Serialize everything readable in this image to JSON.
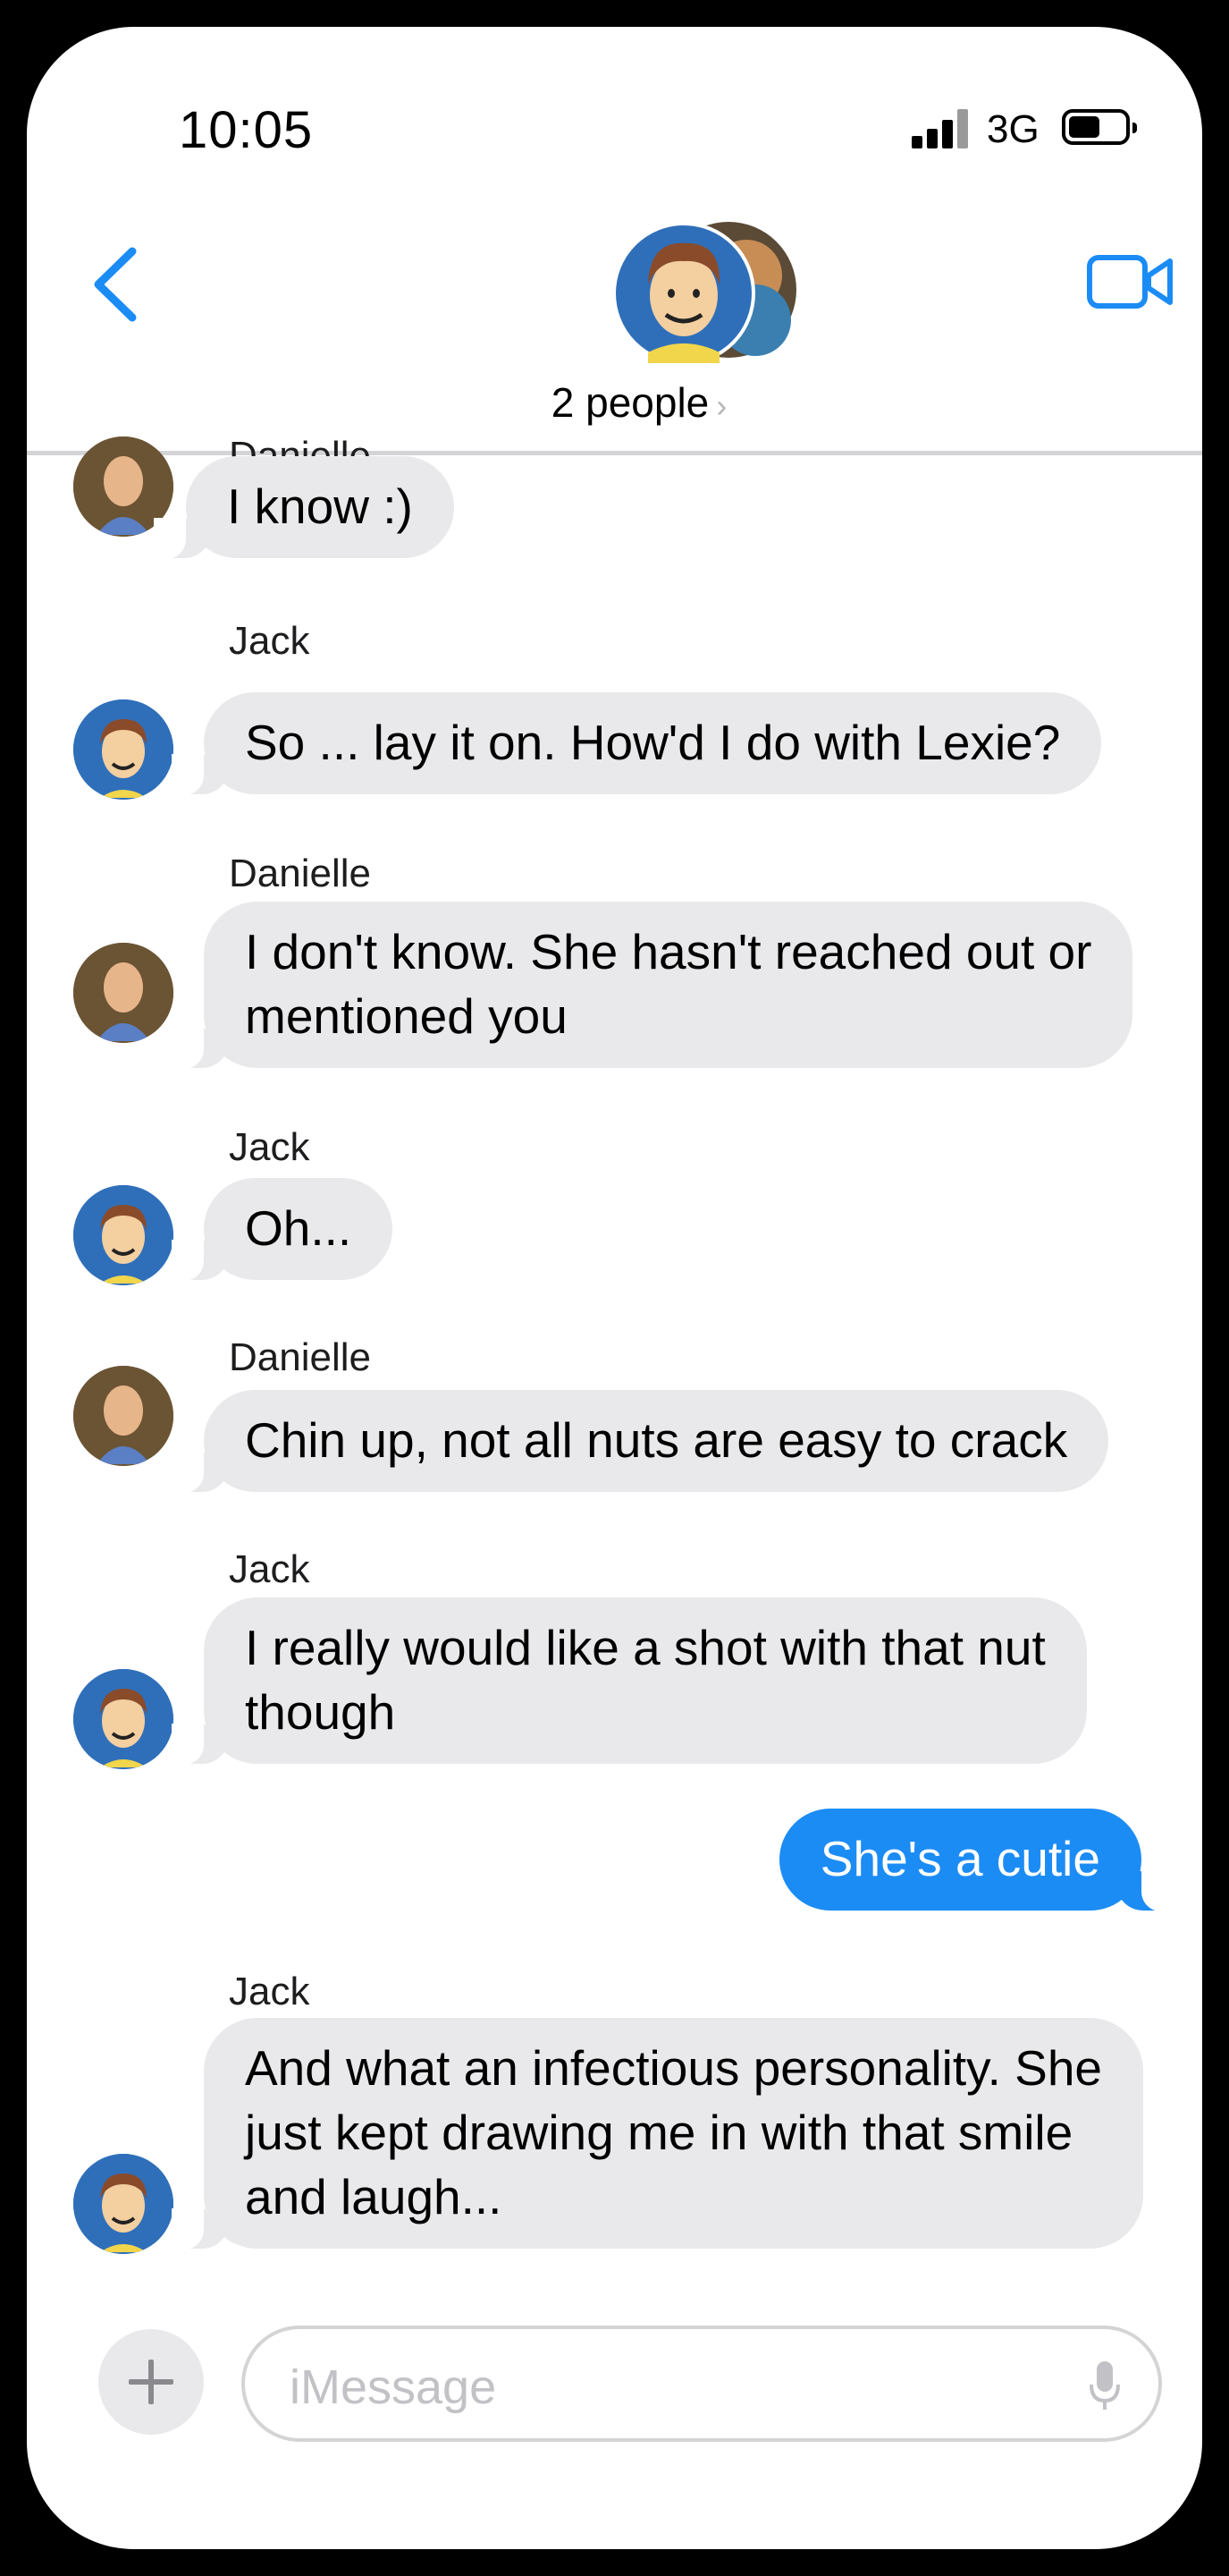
{
  "status_bar": {
    "time": "10:05",
    "network": "3G"
  },
  "header": {
    "title": "2 people",
    "chevron": "›"
  },
  "messages": [
    {
      "sender": "Danielle",
      "text": "I know :)"
    },
    {
      "sender": "Jack",
      "text": "So ... lay it on.  How'd I do with Lexie?"
    },
    {
      "sender": "Danielle",
      "text": "I don't know.  She hasn't reached out or\nmentioned you"
    },
    {
      "sender": "Jack",
      "text": "Oh..."
    },
    {
      "sender": "Danielle",
      "text": "Chin up, not all nuts are easy to crack"
    },
    {
      "sender": "Jack",
      "text": "I really would like a shot with that nut\nthough"
    },
    {
      "sender": "me",
      "text": "She's a cutie"
    },
    {
      "sender": "Jack",
      "text": "And what an infectious personality.  She\njust kept drawing me in with that smile\nand laugh..."
    }
  ],
  "input": {
    "placeholder": "iMessage"
  },
  "colors": {
    "accent": "#1c8cf5",
    "received_bubble": "#e9e9eb"
  }
}
